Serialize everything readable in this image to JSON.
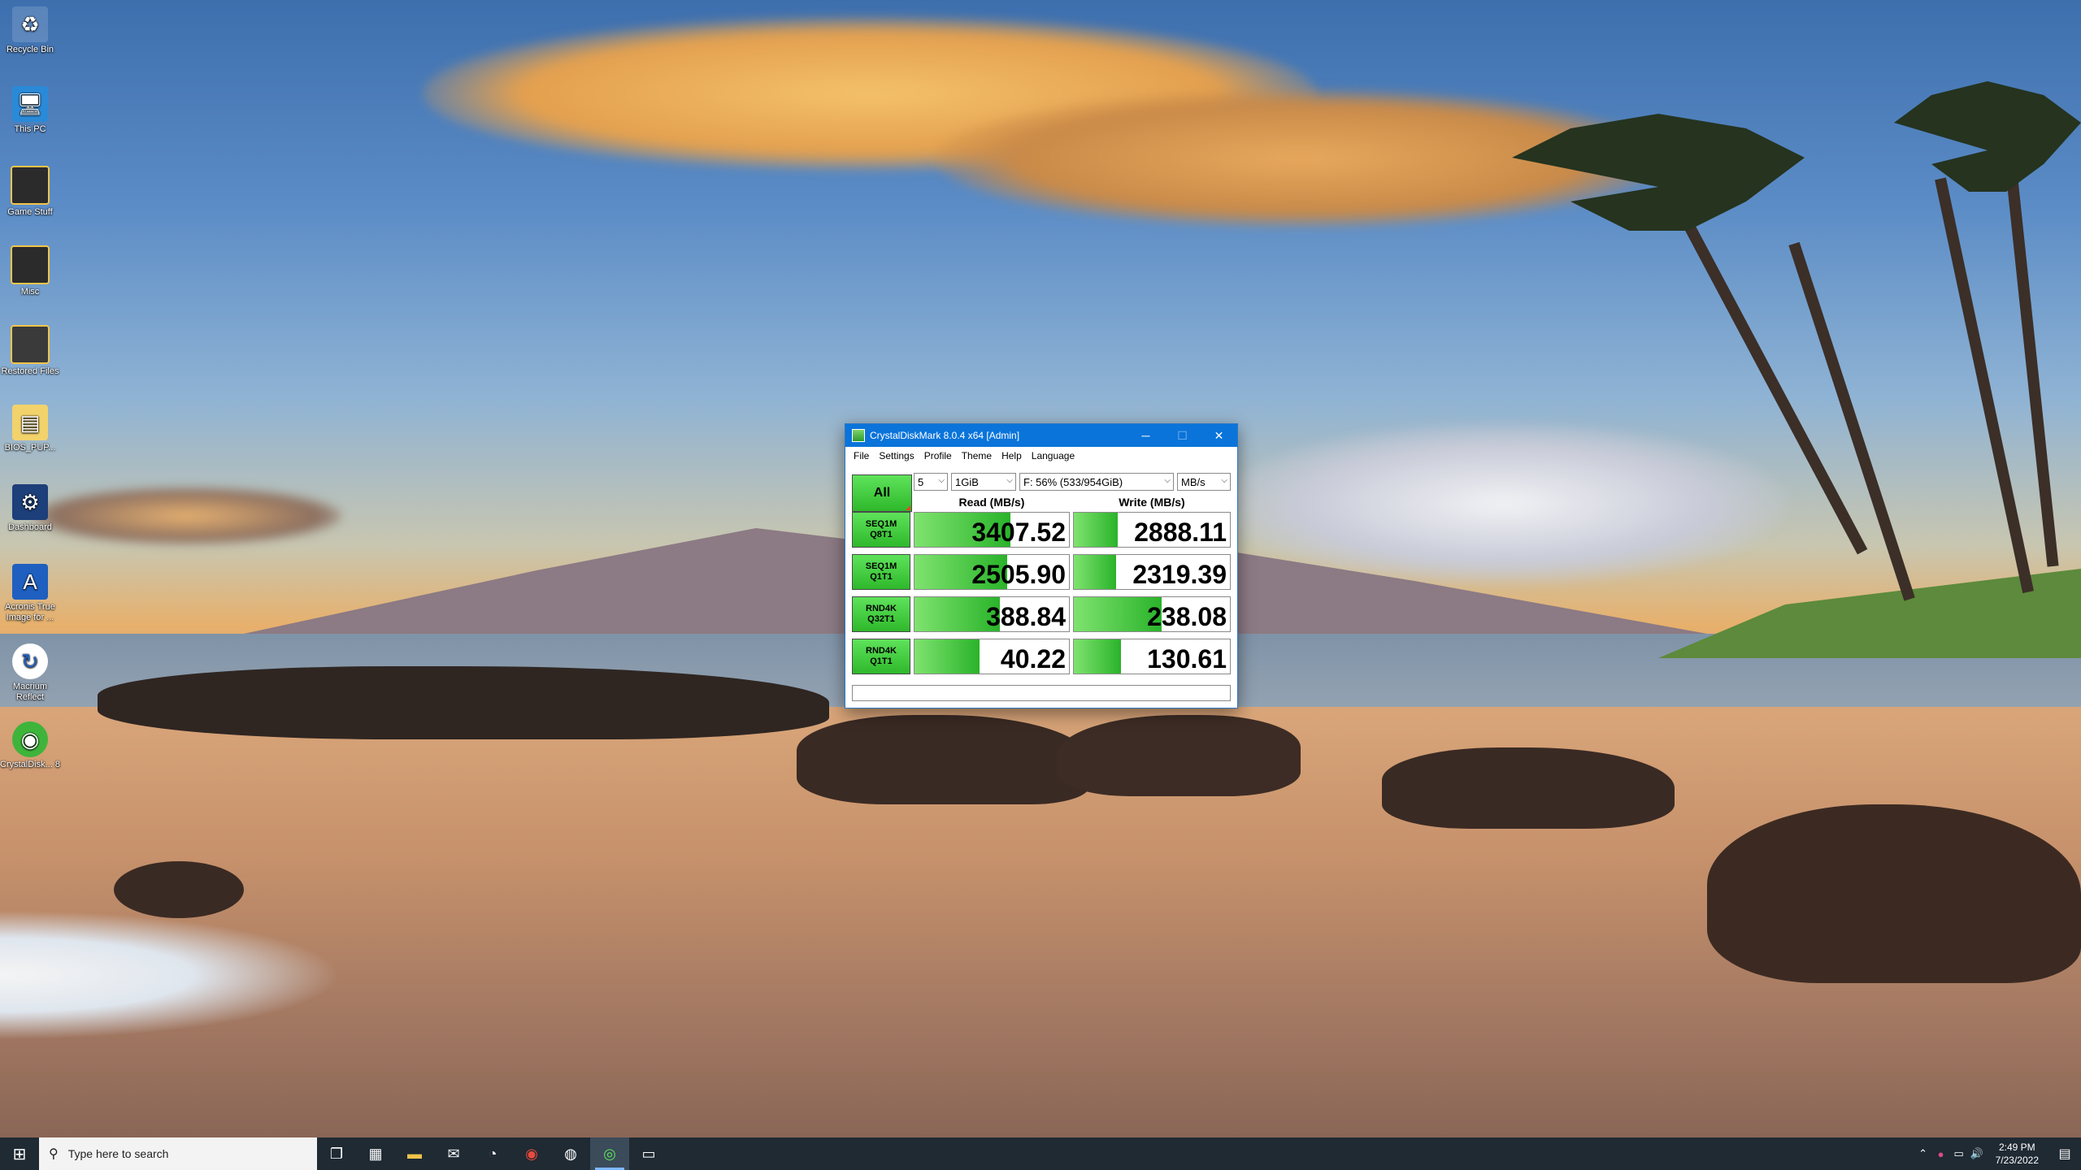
{
  "desktop_icons": [
    {
      "label": "Recycle Bin",
      "icon": "recycle-bin-icon"
    },
    {
      "label": "This PC",
      "icon": "this-pc-icon"
    },
    {
      "label": "Game Stuff",
      "icon": "folder-icon"
    },
    {
      "label": "Misc",
      "icon": "folder-icon"
    },
    {
      "label": "Restored Files",
      "icon": "folder-icon"
    },
    {
      "label": "BIOS_PUP...",
      "icon": "zip-folder-icon"
    },
    {
      "label": "Dashboard",
      "icon": "dashboard-icon"
    },
    {
      "label": "Acronis True Image for ...",
      "icon": "acronis-icon"
    },
    {
      "label": "Macrium Reflect",
      "icon": "macrium-icon"
    },
    {
      "label": "CrystalDisk... 8",
      "icon": "crystaldiskmark-icon"
    }
  ],
  "window": {
    "title": "CrystalDiskMark 8.0.4 x64 [Admin]",
    "menu": [
      "File",
      "Settings",
      "Profile",
      "Theme",
      "Help",
      "Language"
    ],
    "all_button": "All",
    "count": "5",
    "size": "1GiB",
    "drive": "F: 56% (533/954GiB)",
    "unit": "MB/s",
    "read_header": "Read (MB/s)",
    "write_header": "Write (MB/s)",
    "rows": [
      {
        "line1": "SEQ1M",
        "line2": "Q8T1",
        "read": "3407.52",
        "write": "2888.11",
        "read_fill": 0.62,
        "write_fill": 0.28
      },
      {
        "line1": "SEQ1M",
        "line2": "Q1T1",
        "read": "2505.90",
        "write": "2319.39",
        "read_fill": 0.6,
        "write_fill": 0.27
      },
      {
        "line1": "RND4K",
        "line2": "Q32T1",
        "read": "388.84",
        "write": "238.08",
        "read_fill": 0.55,
        "write_fill": 0.56
      },
      {
        "line1": "RND4K",
        "line2": "Q1T1",
        "read": "40.22",
        "write": "130.61",
        "read_fill": 0.42,
        "write_fill": 0.3
      }
    ]
  },
  "taskbar": {
    "search_placeholder": "Type here to search",
    "time": "2:49 PM",
    "date": "7/23/2022"
  }
}
